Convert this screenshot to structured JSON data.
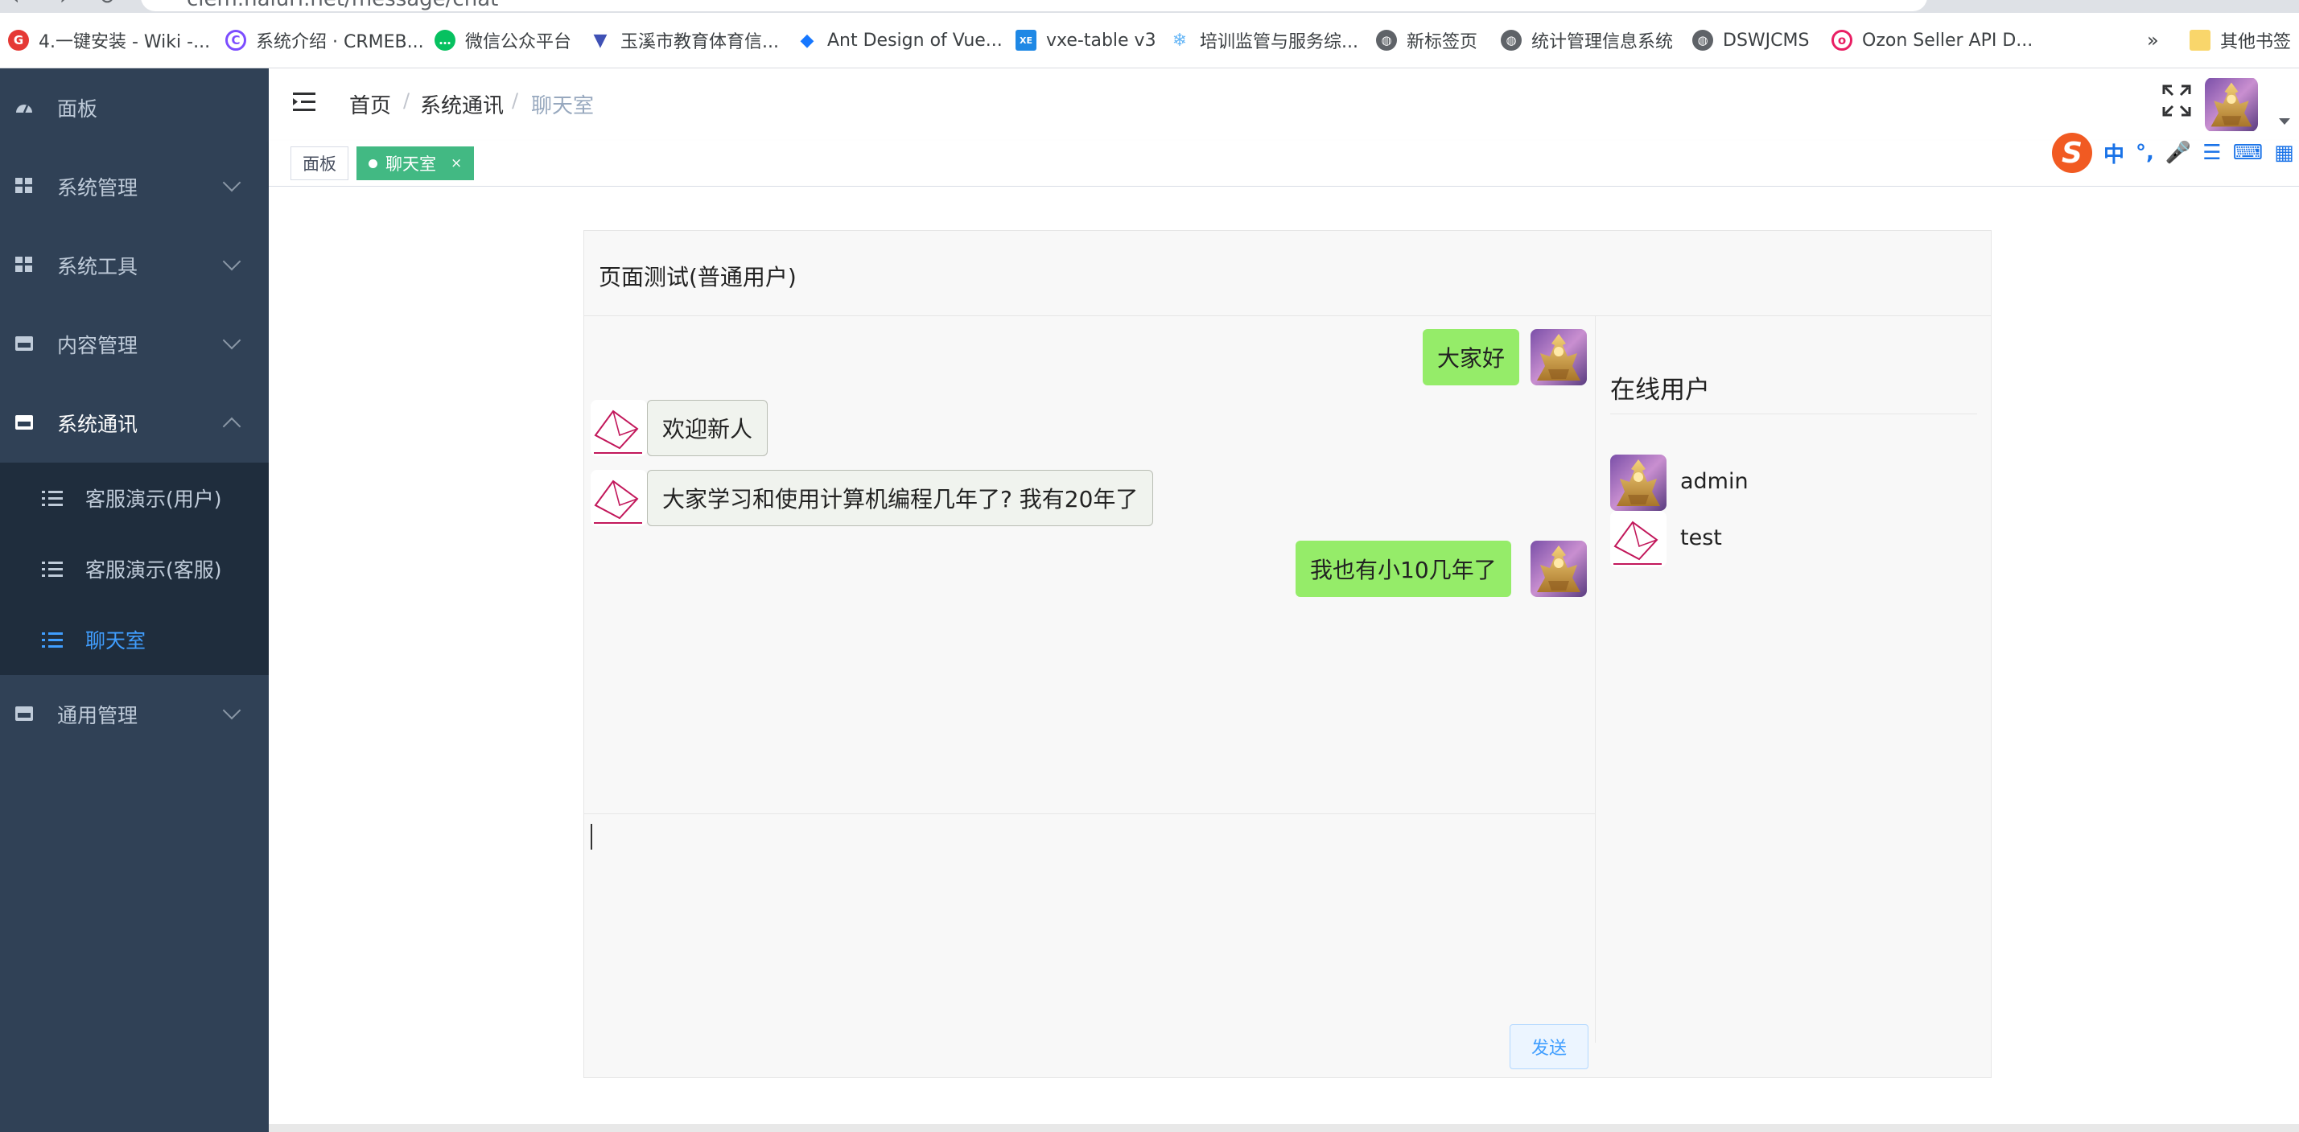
{
  "browser": {
    "url": "clem.haiuri.net/message/chat",
    "bookmarks": [
      {
        "label": "4.一键安装 - Wiki -...",
        "icon": "g-logo-icon",
        "color": "#e53935"
      },
      {
        "label": "系统介绍 · CRMEB...",
        "icon": "c-logo-icon",
        "color": "#7c4dff"
      },
      {
        "label": "微信公众平台",
        "icon": "wechat-icon",
        "color": "#07c160"
      },
      {
        "label": "玉溪市教育体育信...",
        "icon": "vue-icon",
        "color": "#3f51b5"
      },
      {
        "label": "Ant Design of Vue...",
        "icon": "antd-icon",
        "color": "#1677ff"
      },
      {
        "label": "vxe-table v3",
        "icon": "vxe-icon",
        "color": "#1e88e5"
      },
      {
        "label": "培训监管与服务综...",
        "icon": "snowflake-icon",
        "color": "#64b5f6"
      },
      {
        "label": "新标签页",
        "icon": "globe-icon",
        "color": "#5f6368"
      },
      {
        "label": "统计管理信息系统",
        "icon": "globe-icon",
        "color": "#5f6368"
      },
      {
        "label": "DSWJCMS",
        "icon": "globe-icon",
        "color": "#5f6368"
      },
      {
        "label": "Ozon Seller API D...",
        "icon": "ozon-icon",
        "color": "#e91e63"
      }
    ],
    "more": "»",
    "other_bookmarks": "其他书签"
  },
  "sidebar": {
    "items": [
      {
        "label": "面板",
        "icon": "dashboard-icon",
        "expandable": false
      },
      {
        "label": "系统管理",
        "icon": "grid-icon",
        "expandable": true
      },
      {
        "label": "系统工具",
        "icon": "grid-icon",
        "expandable": true
      },
      {
        "label": "内容管理",
        "icon": "pdf-icon",
        "expandable": true
      },
      {
        "label": "系统通讯",
        "icon": "pdf-icon",
        "expandable": true,
        "open": true
      },
      {
        "label": "通用管理",
        "icon": "pdf-icon",
        "expandable": true
      }
    ],
    "submenu": [
      {
        "label": "客服演示(用户)",
        "active": false
      },
      {
        "label": "客服演示(客服)",
        "active": false
      },
      {
        "label": "聊天室",
        "active": true
      }
    ],
    "bg_color": "#304156",
    "active_color": "#409eff"
  },
  "navbar": {
    "breadcrumb": [
      "首页",
      "系统通讯",
      "聊天室"
    ],
    "separator": "/"
  },
  "tags": [
    {
      "label": "面板",
      "active": false
    },
    {
      "label": "聊天室",
      "active": true,
      "close": "×"
    }
  ],
  "ime": {
    "logo": "S",
    "items": [
      "中",
      "°,",
      "🎤",
      "☰",
      "⌨",
      "▦"
    ]
  },
  "chat": {
    "title": "页面测试(普通用户)",
    "messages": [
      {
        "from": "self",
        "text": "大家好",
        "avatar": "golden-knight-avatar"
      },
      {
        "from": "other",
        "text": "欢迎新人",
        "avatar": "envelope-avatar"
      },
      {
        "from": "other",
        "text": "大家学习和使用计算机编程几年了?   我有20年了",
        "avatar": "envelope-avatar"
      },
      {
        "from": "self",
        "text": "我也有小10几年了",
        "avatar": "golden-knight-avatar"
      }
    ],
    "input_value": "",
    "send_label": "发送",
    "online_title": "在线用户",
    "online_users": [
      {
        "name": "admin",
        "avatar": "golden-knight-avatar"
      },
      {
        "name": "test",
        "avatar": "envelope-avatar"
      }
    ],
    "self_bubble_color": "#95ec69",
    "other_bubble_color": "#f0f3ee"
  }
}
